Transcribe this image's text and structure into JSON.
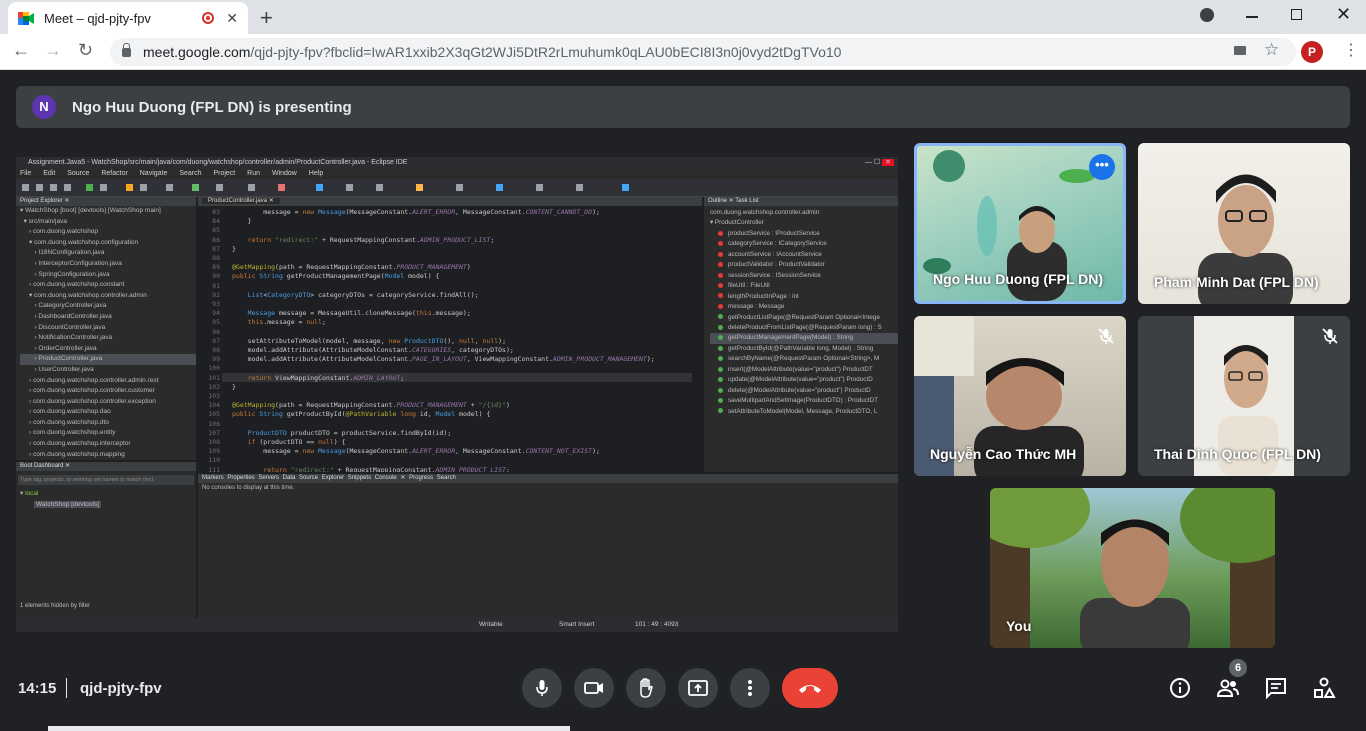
{
  "browser": {
    "tab_title": "Meet – qjd-pjty-fpv",
    "close_tab": "✕",
    "new_tab": "+",
    "url_host": "meet.google.com",
    "url_path": "/qjd-pjty-fpv?fbclid=IwAR1xxib2X3qGt2WJi5DtR2rLmuhumk0qLAU0bECI8I3n0j0vyd2tDgTVo10",
    "profile_initial": "P"
  },
  "banner": {
    "avatar_initial": "N",
    "text": "Ngo Huu Duong (FPL DN) is presenting"
  },
  "ide": {
    "title": "Assignment.Java5 - WatchShop/src/main/java/com/duong/watchshop/controller/admin/ProductController.java - Eclipse IDE",
    "menu": "File Edit Source Refactor Navigate Search Project Run Window Help",
    "project_tab": "Project Explorer ✕",
    "editor_tab": "ProductController.java ✕",
    "outline_tab": "Outline ✕   Task List",
    "boot_tab": "Boot Dashboard ✕",
    "filter_placeholder": "Type tag, projects, or working set names to match (incl.",
    "boot_local": "local",
    "boot_app": "WatchShop [devtools]",
    "hidden_filter": "1 elements hidden by filter",
    "console_tabs": "Markers  Properties  Servers  Data Source Explorer  Snippets  Console ✕  Progress  Search",
    "console_msg": "No consoles to display at this time.",
    "status_writable": "Writable",
    "status_insert": "Smart Insert",
    "status_pos": "101 : 49 : 4093",
    "tree": [
      "▾ WatchShop [boot] [devtools] [WatchShop main]",
      "  ▾ src/main/java",
      "     › com.duong.watchshop",
      "     ▾ com.duong.watchshop.configuration",
      "        › I18NConfiguration.java",
      "        › InterceptorConfiguration.java",
      "        › SpringConfiguration.java",
      "     › com.duong.watchshop.constant",
      "     ▾ com.duong.watchshop.controller.admin",
      "        › CategoryController.java",
      "        › DashboardController.java",
      "        › DiscountController.java",
      "        › NotificationController.java",
      "        › OrderController.java",
      "        › ProductController.java",
      "        › UserController.java",
      "     › com.duong.watchshop.controller.admin.rest",
      "     › com.duong.watchshop.controller.customer",
      "     › com.duong.watchshop.controller.exception",
      "     › com.duong.watchshop.dao",
      "     › com.duong.watchshop.dto",
      "     › com.duong.watchshop.entity",
      "     › com.duong.watchshop.interceptor",
      "     › com.duong.watchshop.mapping"
    ],
    "outline": [
      "com.duong.watchshop.controller.admin",
      "▾ ProductController",
      "productService : IProductService",
      "categoryService : ICategoryService",
      "accountService : IAccountService",
      "productValidator : ProductValidator",
      "sessionService : ISessionService",
      "fileUtil : FileUtil",
      "lengthProductInPage : int",
      "message : Message",
      "getProductListPage(@RequestParam Optional<Intege",
      "deleteProductFromListPage(@RequestParam long) : S",
      "getProductManagementPage(Model) : String",
      "getProductById(@PathVariable long, Model) : String",
      "searchByName(@RequestParam Optional<String>, M",
      "insert(@ModelAttribute(value=\"product\") ProductDT",
      "update(@ModelAttribute(value=\"product\") ProductD",
      "delete(@ModelAttribute(value=\"product\") ProductD",
      "saveMultipartAndSetImage(ProductDTO) : ProductDT",
      "setAttributeToModel(Model, Message, ProductDTO, L"
    ],
    "code": [
      {
        "n": "83",
        "t": "        message = new Message(MessageConstant.ALERT_ERROR, MessageConstant.CONTENT_CANNOT_DO);"
      },
      {
        "n": "84",
        "t": "    }"
      },
      {
        "n": "85",
        "t": ""
      },
      {
        "n": "86",
        "t": "    return \"redirect:\" + RequestMappingConstant.ADMIN_PRODUCT_LIST;"
      },
      {
        "n": "87",
        "t": "}"
      },
      {
        "n": "88",
        "t": ""
      },
      {
        "n": "89",
        "t": "@GetMapping(path = RequestMappingConstant.PRODUCT_MANAGEMENT)"
      },
      {
        "n": "90",
        "t": "public String getProductManagementPage(Model model) {"
      },
      {
        "n": "91",
        "t": ""
      },
      {
        "n": "92",
        "t": "    List<CategoryDTO> categoryDTOs = categoryService.findAll();"
      },
      {
        "n": "93",
        "t": ""
      },
      {
        "n": "94",
        "t": "    Message message = MessageUtil.cloneMessage(this.message);"
      },
      {
        "n": "95",
        "t": "    this.message = null;"
      },
      {
        "n": "96",
        "t": ""
      },
      {
        "n": "97",
        "t": "    setAttributeToModel(model, message, new ProductDTO(), null, null);"
      },
      {
        "n": "98",
        "t": "    model.addAttribute(AttributeModelConstant.CATEGORIES, categoryDTOs);"
      },
      {
        "n": "99",
        "t": "    model.addAttribute(AttributeModelConstant.PAGE_IN_LAYOUT, ViewMappingConstant.ADMIN_PRODUCT_MANAGEMENT);"
      },
      {
        "n": "100",
        "t": ""
      },
      {
        "n": "101",
        "t": "    return ViewMappingConstant.ADMIN_LAYOUT;"
      },
      {
        "n": "102",
        "t": "}"
      },
      {
        "n": "103",
        "t": ""
      },
      {
        "n": "104",
        "t": "@GetMapping(path = RequestMappingConstant.PRODUCT_MANAGEMENT + \"/{id}\")"
      },
      {
        "n": "105",
        "t": "public String getProductById(@PathVariable long id, Model model) {"
      },
      {
        "n": "106",
        "t": ""
      },
      {
        "n": "107",
        "t": "    ProductDTO productDTO = productService.findById(id);"
      },
      {
        "n": "108",
        "t": "    if (productDTO == null) {"
      },
      {
        "n": "109",
        "t": "        message = new Message(MessageConstant.ALERT_ERROR, MessageConstant.CONTENT_NOT_EXIST);"
      },
      {
        "n": "110",
        "t": ""
      },
      {
        "n": "111",
        "t": "        return \"redirect:\" + RequestMappingConstant.ADMIN_PRODUCT_LIST;"
      }
    ]
  },
  "participants": [
    {
      "name": "Ngo Huu Duong (FPL DN)",
      "more": "•••"
    },
    {
      "name": "Pham Minh Dat (FPL DN)"
    },
    {
      "name": "Nguyễn Cao Thức MH"
    },
    {
      "name": "Thai Dinh Quoc (FPL DN)"
    },
    {
      "name": "You"
    }
  ],
  "controls": {
    "time": "14:15",
    "meeting_code": "qjd-pjty-fpv",
    "people_count": "6"
  },
  "colors": {
    "meet_bg": "#202124",
    "end_call": "#ea4335",
    "active_speaker": "#8ab4f8",
    "more_button": "#1a73e8"
  }
}
